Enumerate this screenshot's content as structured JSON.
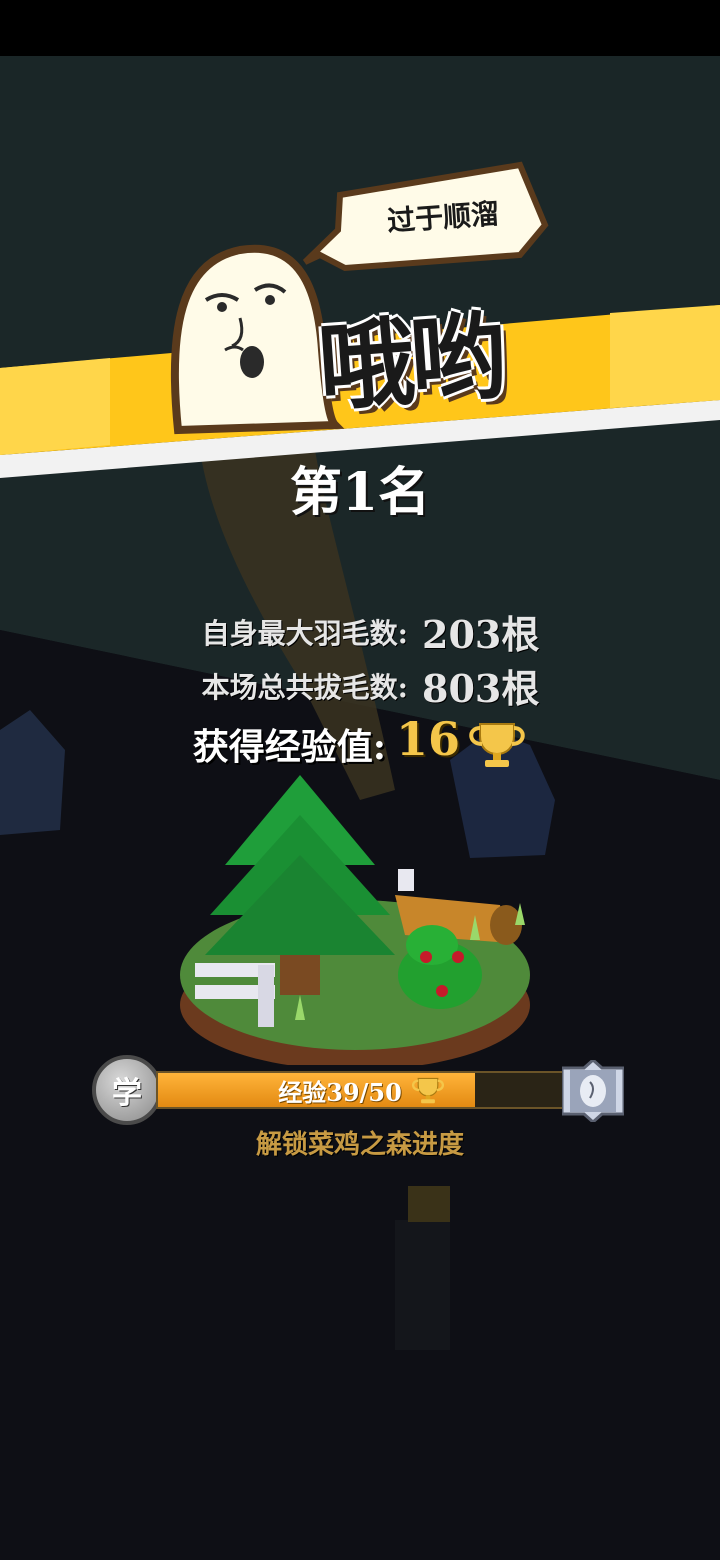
{
  "speech_bubble": {
    "text": "过于顺溜"
  },
  "banner": {
    "title": "哦哟"
  },
  "result": {
    "rank": "第1名"
  },
  "stats": {
    "max_feathers_label": "自身最大羽毛数:",
    "max_feathers_value": "203根",
    "total_plucked_label": "本场总共拔毛数:",
    "total_plucked_value": "803根",
    "exp_label": "获得经验值:",
    "exp_value": "16"
  },
  "progress": {
    "badge_label": "学",
    "text": "经验39/50",
    "current": 39,
    "max": 50,
    "caption": "解锁菜鸡之森进度"
  },
  "colors": {
    "banner_yellow": "#ffc61a",
    "gold_text": "#f4c64a",
    "bar_fill": "#f0a020"
  }
}
